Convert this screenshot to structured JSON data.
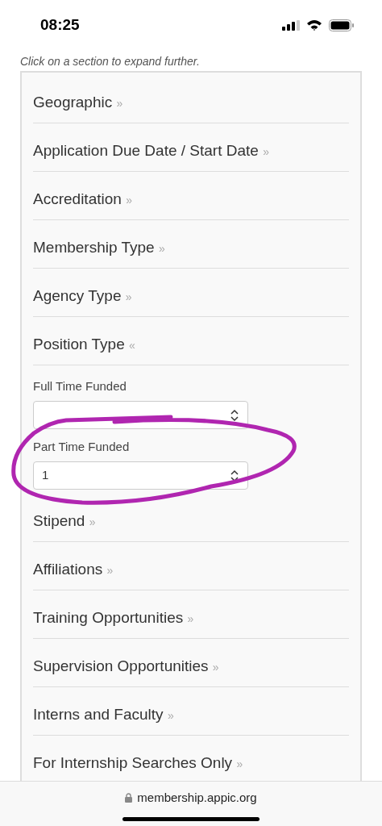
{
  "status_bar": {
    "time": "08:25"
  },
  "hint": "Click on a section to expand further.",
  "sections": [
    {
      "title": "Geographic",
      "marker": "»"
    },
    {
      "title": "Application Due Date / Start Date",
      "marker": "»"
    },
    {
      "title": "Accreditation",
      "marker": "»"
    },
    {
      "title": "Membership Type",
      "marker": "»"
    },
    {
      "title": "Agency Type",
      "marker": "»"
    },
    {
      "title": "Position Type",
      "marker": "«",
      "fields": [
        {
          "label": "Full Time Funded"
        },
        {
          "label": "Part Time Funded",
          "value": "1"
        }
      ]
    },
    {
      "title": "Stipend",
      "marker": "»"
    },
    {
      "title": "Affiliations",
      "marker": "»"
    },
    {
      "title": "Training Opportunities",
      "marker": "»"
    },
    {
      "title": "Supervision Opportunities",
      "marker": "»"
    },
    {
      "title": "Interns and Faculty",
      "marker": "»"
    },
    {
      "title": "For Internship Searches Only",
      "marker": "»"
    }
  ],
  "annotation": {
    "kind": "ellipse"
  },
  "browser_bar": {
    "url": "membership.appic.org"
  }
}
